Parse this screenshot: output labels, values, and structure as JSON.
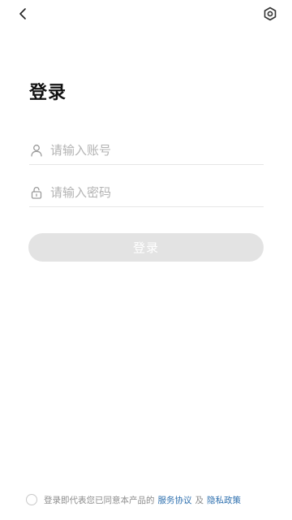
{
  "header": {
    "back_icon": "chevron-left-icon",
    "settings_icon": "gear-icon"
  },
  "title": "登录",
  "account_field": {
    "icon": "user-icon",
    "value": "",
    "placeholder": "请输入账号"
  },
  "password_field": {
    "icon": "lock-icon",
    "value": "",
    "placeholder": "请输入密码"
  },
  "login_button": {
    "label": "登录",
    "color": "#e3e3e3"
  },
  "agreement": {
    "text": "登录即代表您已同意本产品的",
    "service_link": "服务协议",
    "conjunction": "及",
    "privacy_link": "隐私政策",
    "link_color": "#2d6fae"
  }
}
